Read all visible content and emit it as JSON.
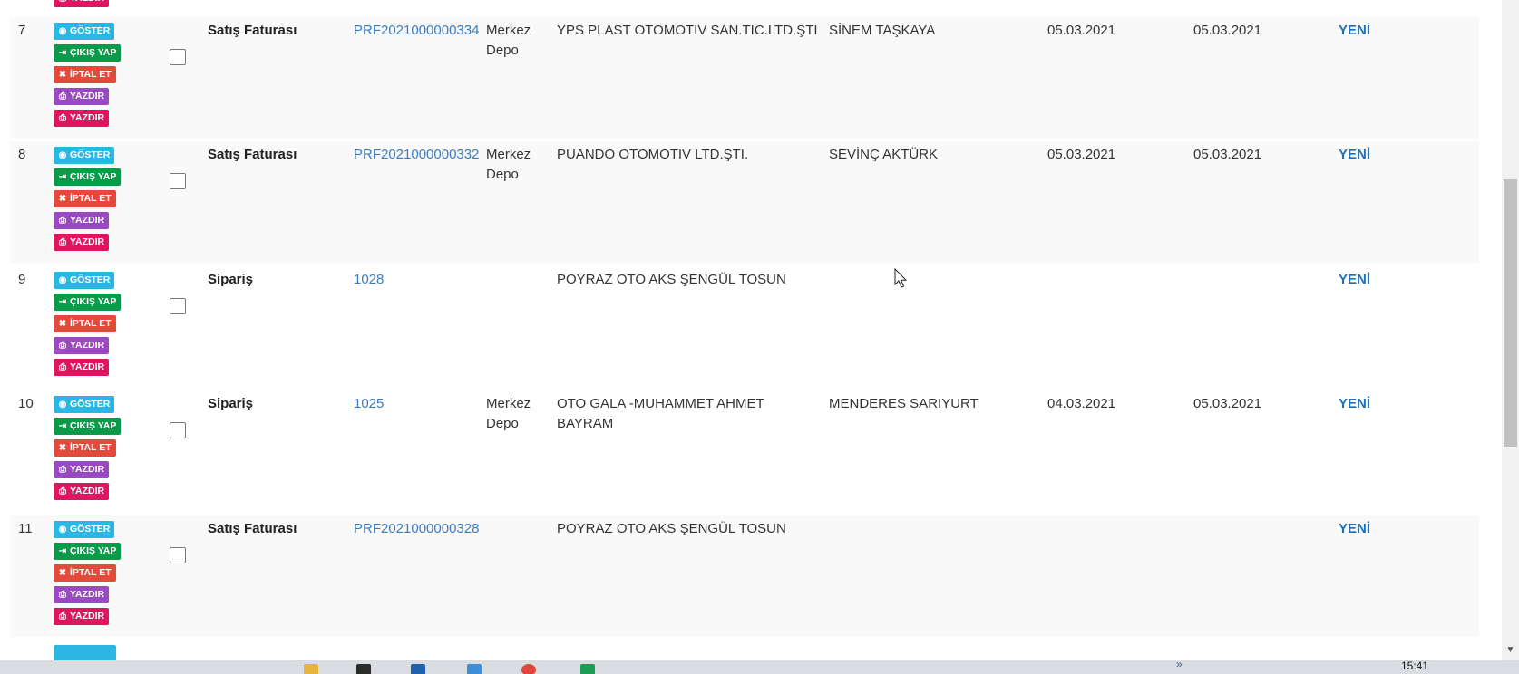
{
  "buttons": {
    "show": "GÖSTER",
    "exit": "ÇIKIŞ YAP",
    "cancel": "İPTAL ET",
    "print": "YAZDIR"
  },
  "rows": [
    {
      "no": "7",
      "type": "Satış Faturası",
      "ref": "PRF2021000000334",
      "depot": "Merkez Depo",
      "customer": "YPS PLAST OTOMOTIV SAN.TIC.LTD.ŞTI",
      "user": "SİNEM TAŞKAYA",
      "date1": "05.03.2021",
      "date2": "05.03.2021",
      "status": "YENİ"
    },
    {
      "no": "8",
      "type": "Satış Faturası",
      "ref": "PRF2021000000332",
      "depot": "Merkez Depo",
      "customer": "PUANDO OTOMOTIV LTD.ŞTI.",
      "user": "SEVİNÇ AKTÜRK",
      "date1": "05.03.2021",
      "date2": "05.03.2021",
      "status": "YENİ"
    },
    {
      "no": "9",
      "type": "Sipariş",
      "ref": "1028",
      "depot": "",
      "customer": "POYRAZ OTO AKS ŞENGÜL TOSUN",
      "user": "",
      "date1": "",
      "date2": "",
      "status": "YENİ"
    },
    {
      "no": "10",
      "type": "Sipariş",
      "ref": "1025",
      "depot": "Merkez Depo",
      "customer": "OTO GALA -MUHAMMET AHMET BAYRAM",
      "user": "MENDERES SARIYURT",
      "date1": "04.03.2021",
      "date2": "05.03.2021",
      "status": "YENİ"
    },
    {
      "no": "11",
      "type": "Satış Faturası",
      "ref": "PRF2021000000328",
      "depot": "",
      "customer": "POYRAZ OTO AKS ŞENGÜL TOSUN",
      "user": "",
      "date1": "",
      "date2": "",
      "status": "YENİ"
    }
  ],
  "taskbar": {
    "clock": "15:41"
  }
}
